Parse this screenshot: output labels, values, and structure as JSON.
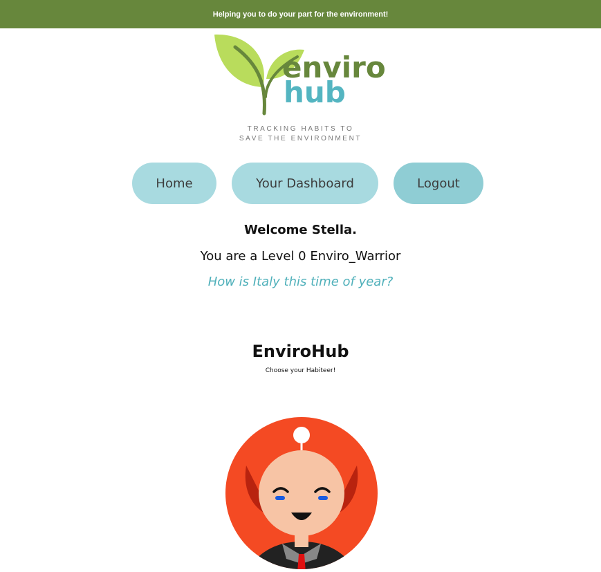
{
  "banner": {
    "text": "Helping you to do your part for the environment!",
    "color": "#67873c"
  },
  "logo": {
    "word1": "enviro",
    "word2": "hub",
    "tagline_line1": "TRACKING HABITS TO",
    "tagline_line2": "SAVE THE ENVIRONMENT",
    "color_green": "#67873c",
    "color_teal": "#54b5c1",
    "color_leaf": "#b9dc5c"
  },
  "nav": {
    "home_label": "Home",
    "dashboard_label": "Your Dashboard",
    "logout_label": "Logout",
    "button_color": "#a8dae0",
    "active_color": "#8fcdd4"
  },
  "main": {
    "welcome": "Welcome Stella.",
    "level": "You are a Level 0 Enviro_Warrior",
    "question": "How is Italy this time of year?",
    "question_color": "#4fb0ba"
  },
  "habiteer": {
    "title": "EnviroHub",
    "subtitle": "Choose your Habiteer!",
    "avatar_icon": "habiteer-avatar-icon",
    "avatar_bg_color": "#f44a23"
  }
}
